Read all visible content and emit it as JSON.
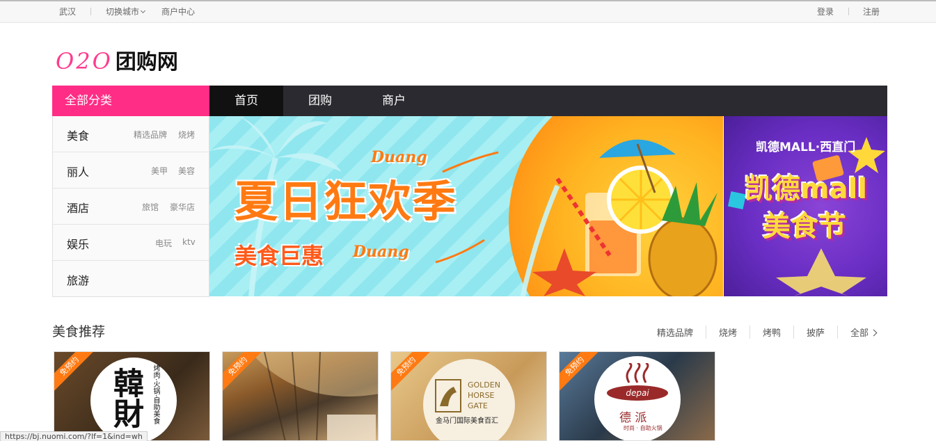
{
  "topbar": {
    "city": "武汉",
    "switch_city": "切换城市",
    "merchant_center": "商户中心",
    "login": "登录",
    "register": "注册"
  },
  "logo": {
    "latin": "O2O",
    "chinese": "团购网"
  },
  "nav": {
    "all_categories": "全部分类",
    "tabs": [
      {
        "label": "首页"
      },
      {
        "label": "团购"
      },
      {
        "label": "商户"
      }
    ],
    "active_tab": "首页"
  },
  "categories": [
    {
      "name": "美食",
      "subs": [
        "精选品牌",
        "烧烤"
      ]
    },
    {
      "name": "丽人",
      "subs": [
        "美甲",
        "美容"
      ]
    },
    {
      "name": "酒店",
      "subs": [
        "旅馆",
        "豪华店"
      ]
    },
    {
      "name": "娱乐",
      "subs": [
        "电玩",
        "ktv"
      ]
    },
    {
      "name": "旅游",
      "subs": []
    }
  ],
  "banner": {
    "title": "夏日狂欢季",
    "subtitle": "美食巨惠",
    "duang": "Duang"
  },
  "side_ad": {
    "header": "凯德MALL·西直门",
    "line1": "凯德mall",
    "line2": "美食节"
  },
  "section": {
    "title": "美食推荐",
    "links": [
      "精选品牌",
      "烧烤",
      "烤鸭",
      "披萨"
    ],
    "all_link": "全部"
  },
  "cards": [
    {
      "badge": "免预约",
      "logo_main": "韓財",
      "logo_side": "烤肉·火锅·自助美食"
    },
    {
      "badge": "免预约"
    },
    {
      "badge": "免预约",
      "logo_line1": "GOLDEN",
      "logo_line2": "HORSE",
      "logo_line3": "GATE",
      "logo_cn": "金马门国际美食百汇"
    },
    {
      "badge": "免预约",
      "logo_latin": "depai",
      "logo_cn": "德 派",
      "logo_small": "时尚 · 自助火锅"
    }
  ],
  "status_url": "https://bj.nuomi.com/?lf=1&ind=wh",
  "colors": {
    "accent_pink": "#ff2d86",
    "nav_dark": "#2b2a30",
    "badge_orange": "#ff7a12"
  }
}
